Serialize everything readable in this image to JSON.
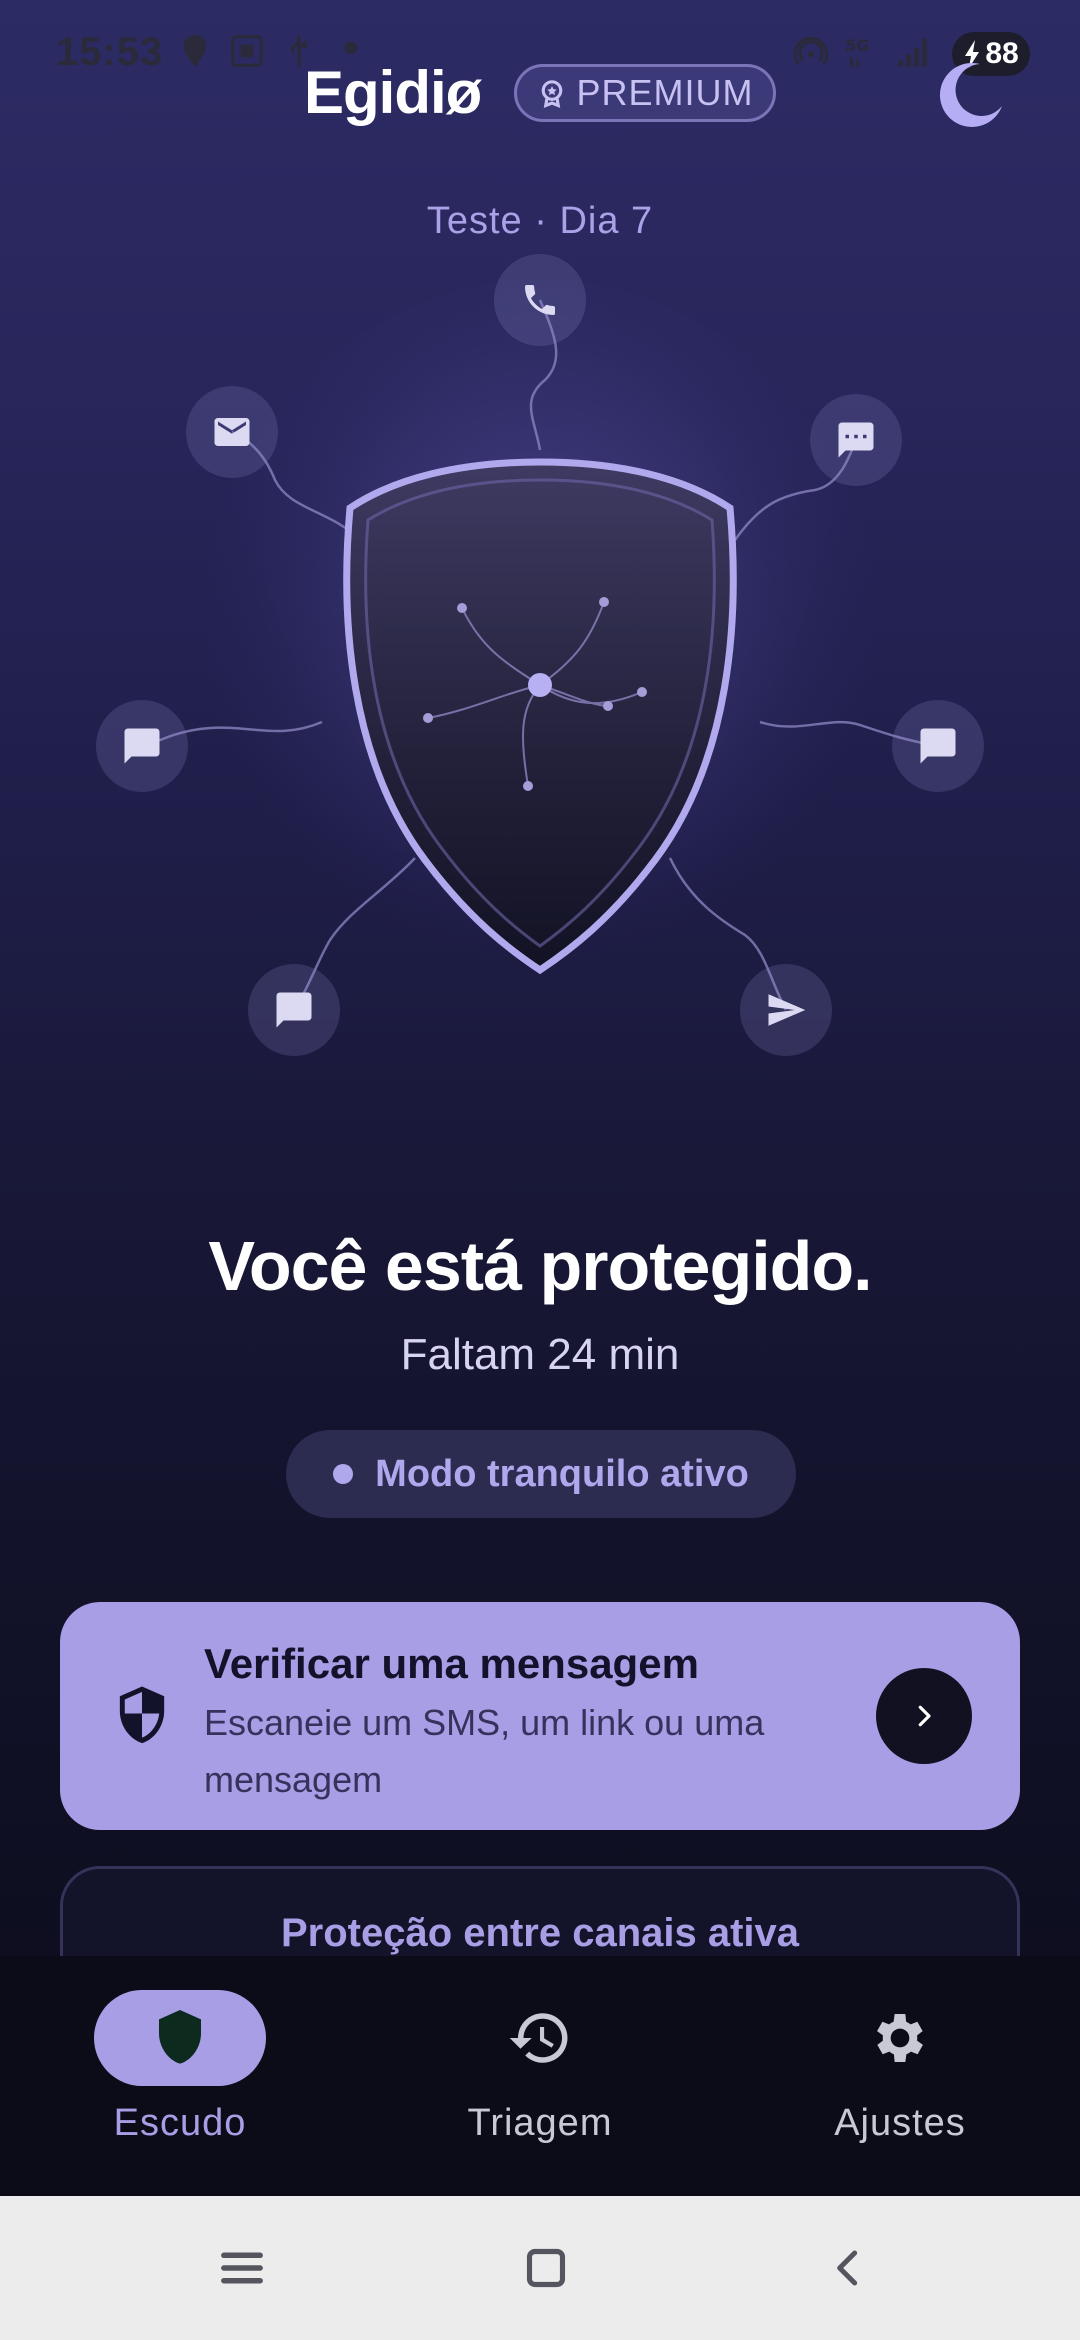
{
  "status_bar": {
    "time": "15:53",
    "battery": "88",
    "network": "5G"
  },
  "header": {
    "app_name": "Egidiø",
    "premium_label": "PREMIUM",
    "theme_icon": "moon-icon"
  },
  "trial": {
    "label": "Teste · Dia 7"
  },
  "hero": {
    "shield_icon": "shield-icon",
    "channels": [
      "phone-icon",
      "mail-icon",
      "chat-dots-icon",
      "message-icon",
      "message-icon",
      "message-icon",
      "send-icon"
    ]
  },
  "status": {
    "title": "Você está protegido.",
    "time_left": "Faltam 24 min",
    "mode": "Modo tranquilo ativo"
  },
  "verify_card": {
    "title": "Verificar uma mensagem",
    "description": "Escaneie um SMS, um link ou uma mensagem"
  },
  "channels_card": {
    "title": "Proteção entre canais ativa"
  },
  "bottom_nav": {
    "items": [
      {
        "label": "Escudo",
        "icon": "shield-icon",
        "active": true
      },
      {
        "label": "Triagem",
        "icon": "history-icon",
        "active": false
      },
      {
        "label": "Ajustes",
        "icon": "gear-icon",
        "active": false
      }
    ]
  },
  "colors": {
    "accent": "#a89ee6",
    "background_top": "#2d2b64",
    "background_bottom": "#0e0e20",
    "nav_background": "#0b0c18"
  }
}
